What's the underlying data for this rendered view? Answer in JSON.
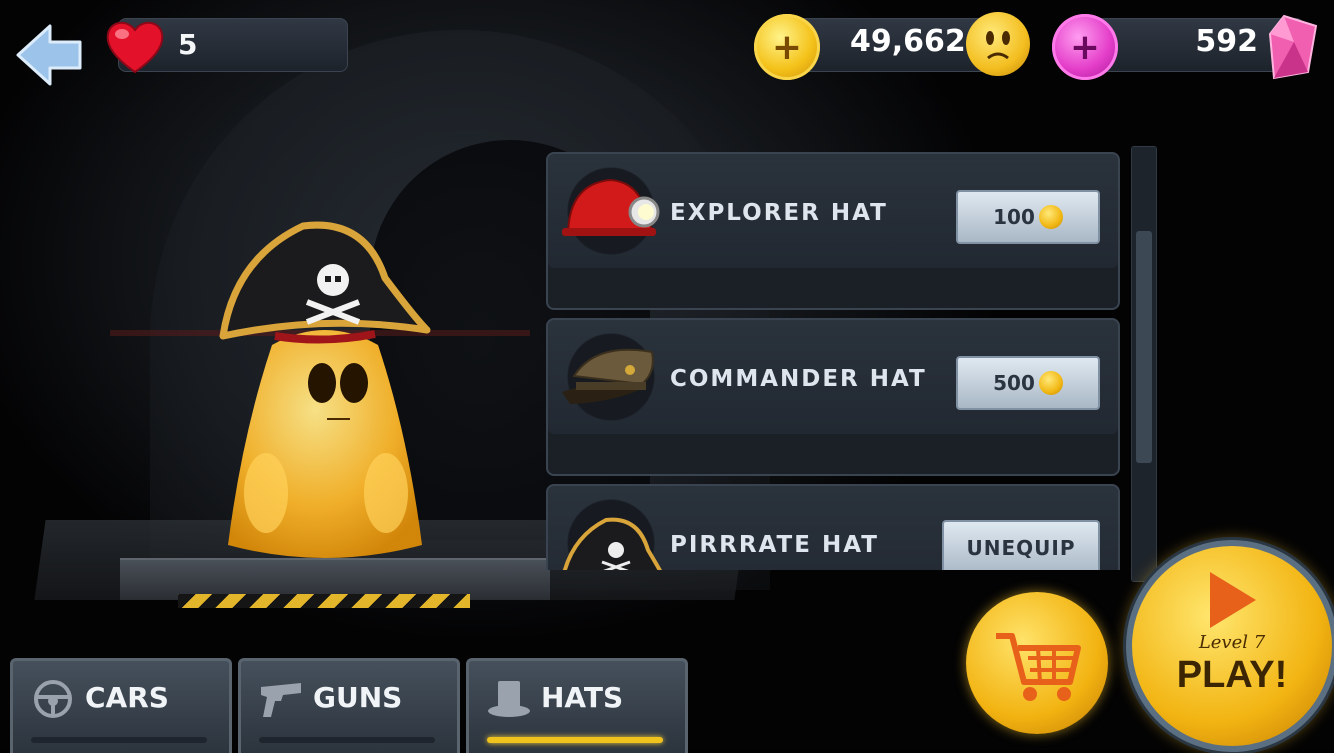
{
  "header": {
    "lives": "5",
    "coins": "49,662",
    "gems": "592",
    "plus_symbol": "+"
  },
  "shop": {
    "items": [
      {
        "name": "EXPLORER HAT",
        "price": "100",
        "icon": "miner-helmet-icon"
      },
      {
        "name": "COMMANDER HAT",
        "price": "500",
        "icon": "officer-cap-icon"
      },
      {
        "name": "PIRRRATE HAT",
        "action": "UNEQUIP",
        "icon": "pirate-hat-icon"
      }
    ]
  },
  "tabs": [
    {
      "label": "CARS",
      "icon": "steering-wheel-icon",
      "active": false
    },
    {
      "label": "GUNS",
      "icon": "pistol-icon",
      "active": false
    },
    {
      "label": "HATS",
      "icon": "top-hat-icon",
      "active": true
    }
  ],
  "play": {
    "level_label": "Level 7",
    "play_label": "PLAY!"
  },
  "colors": {
    "coin": "#f2b412",
    "gem": "#e43ec9",
    "active_tab_bar": "#f0c21e",
    "panel": "#222932"
  }
}
